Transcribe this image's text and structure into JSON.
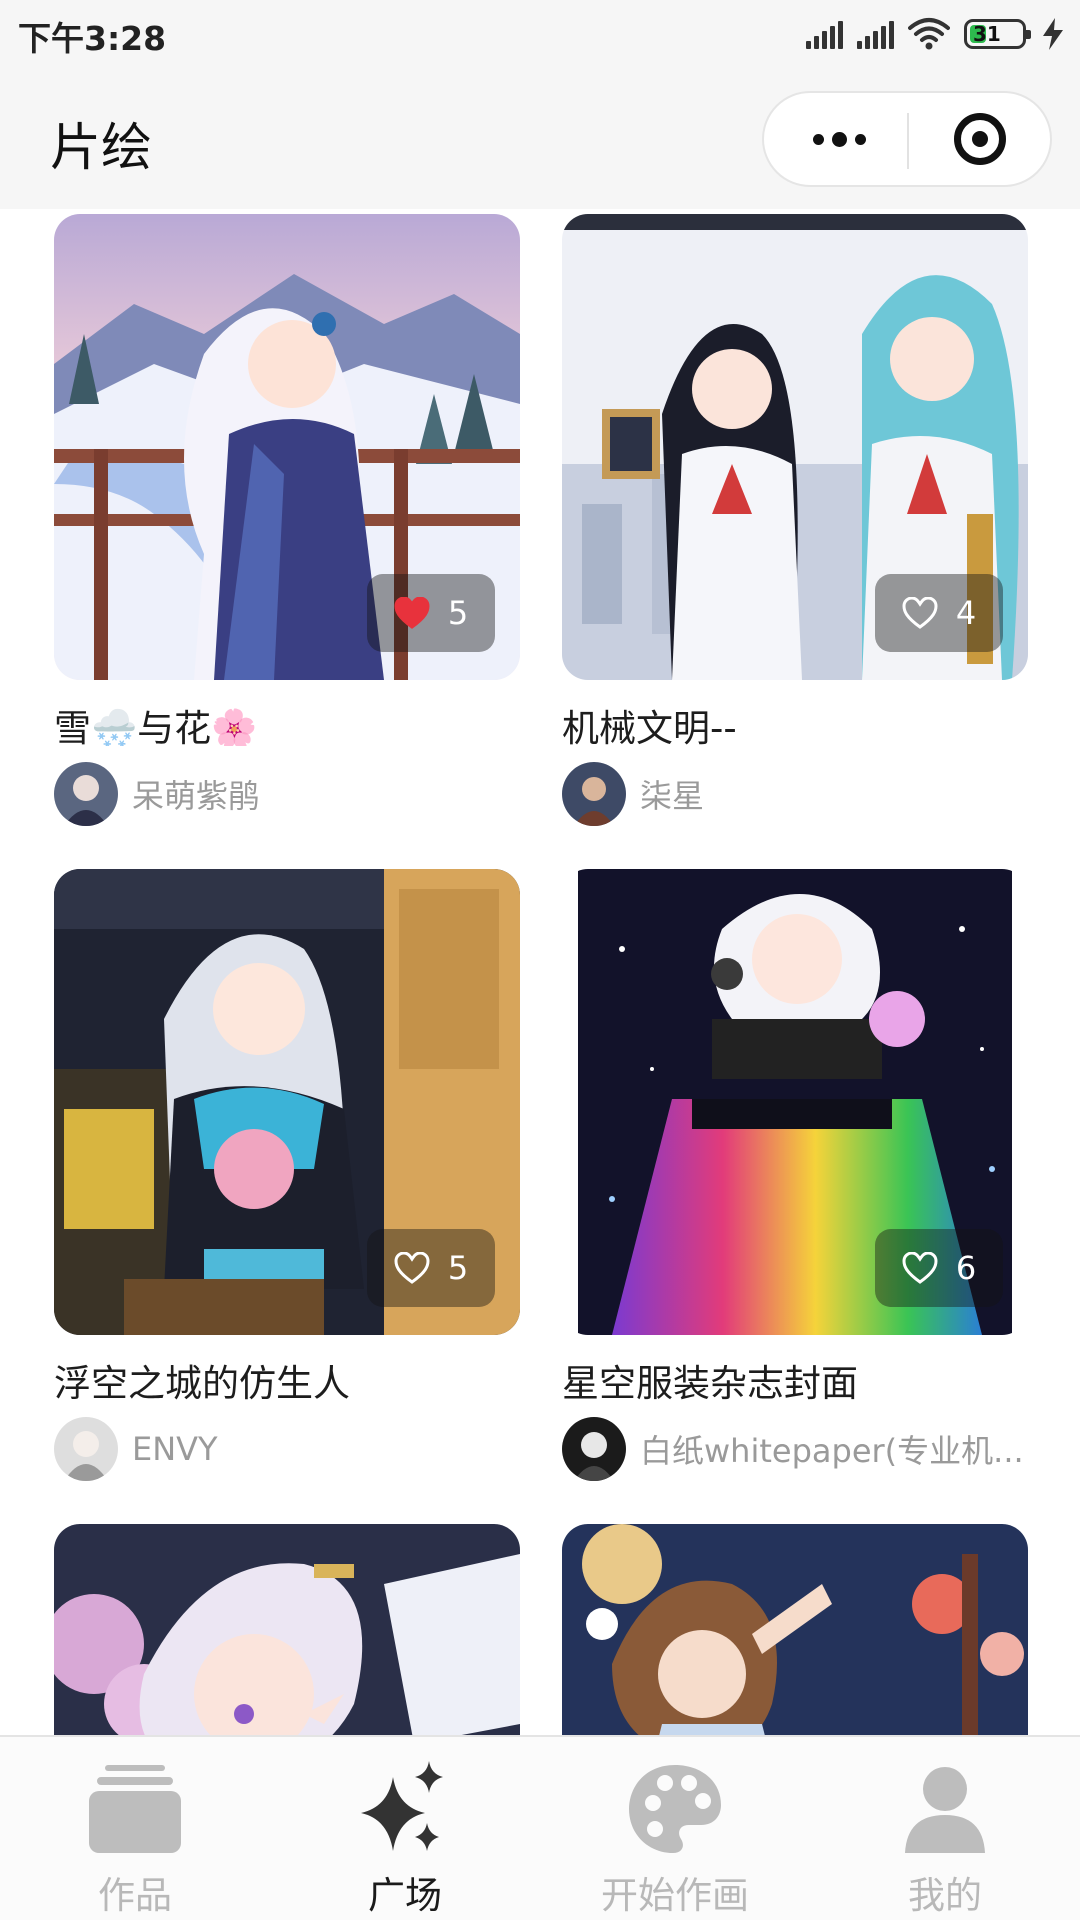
{
  "status_bar": {
    "time": "下午3:28",
    "battery_level": "31",
    "battery_fraction": 0.31,
    "battery_color": "#2dbb4e",
    "icons": [
      "signal-icon",
      "signal-icon",
      "wifi-icon",
      "battery-icon",
      "charging-icon"
    ]
  },
  "nav": {
    "title": "片绘",
    "icons": [
      "more-icon",
      "target-icon"
    ]
  },
  "cards": [
    {
      "title": "雪🌨️与花🌸",
      "author": "呆萌紫鹃",
      "likes": "5",
      "liked": true
    },
    {
      "title": "机械文明--",
      "author": "柒星",
      "likes": "4",
      "liked": false
    },
    {
      "title": "浮空之城的仿生人",
      "author": "ENVY",
      "likes": "5",
      "liked": false
    },
    {
      "title": "星空服装杂志封面",
      "author": "白纸whitepaper(专业机...",
      "likes": "6",
      "liked": false
    },
    {
      "title": "",
      "author": "",
      "likes": "",
      "liked": false
    },
    {
      "title": "",
      "author": "",
      "likes": "",
      "liked": false
    }
  ],
  "tab_bar": {
    "tabs": [
      {
        "label": "作品",
        "icon": "artworks-icon",
        "active": false
      },
      {
        "label": "广场",
        "icon": "sparkles-icon",
        "active": true
      },
      {
        "label": "开始作画",
        "icon": "palette-icon",
        "active": false
      },
      {
        "label": "我的",
        "icon": "profile-icon",
        "active": false
      }
    ]
  },
  "colors": {
    "like_active": "#e8323c",
    "tab_active": "#1a1a1a",
    "tab_inactive": "#b8b8b8"
  }
}
